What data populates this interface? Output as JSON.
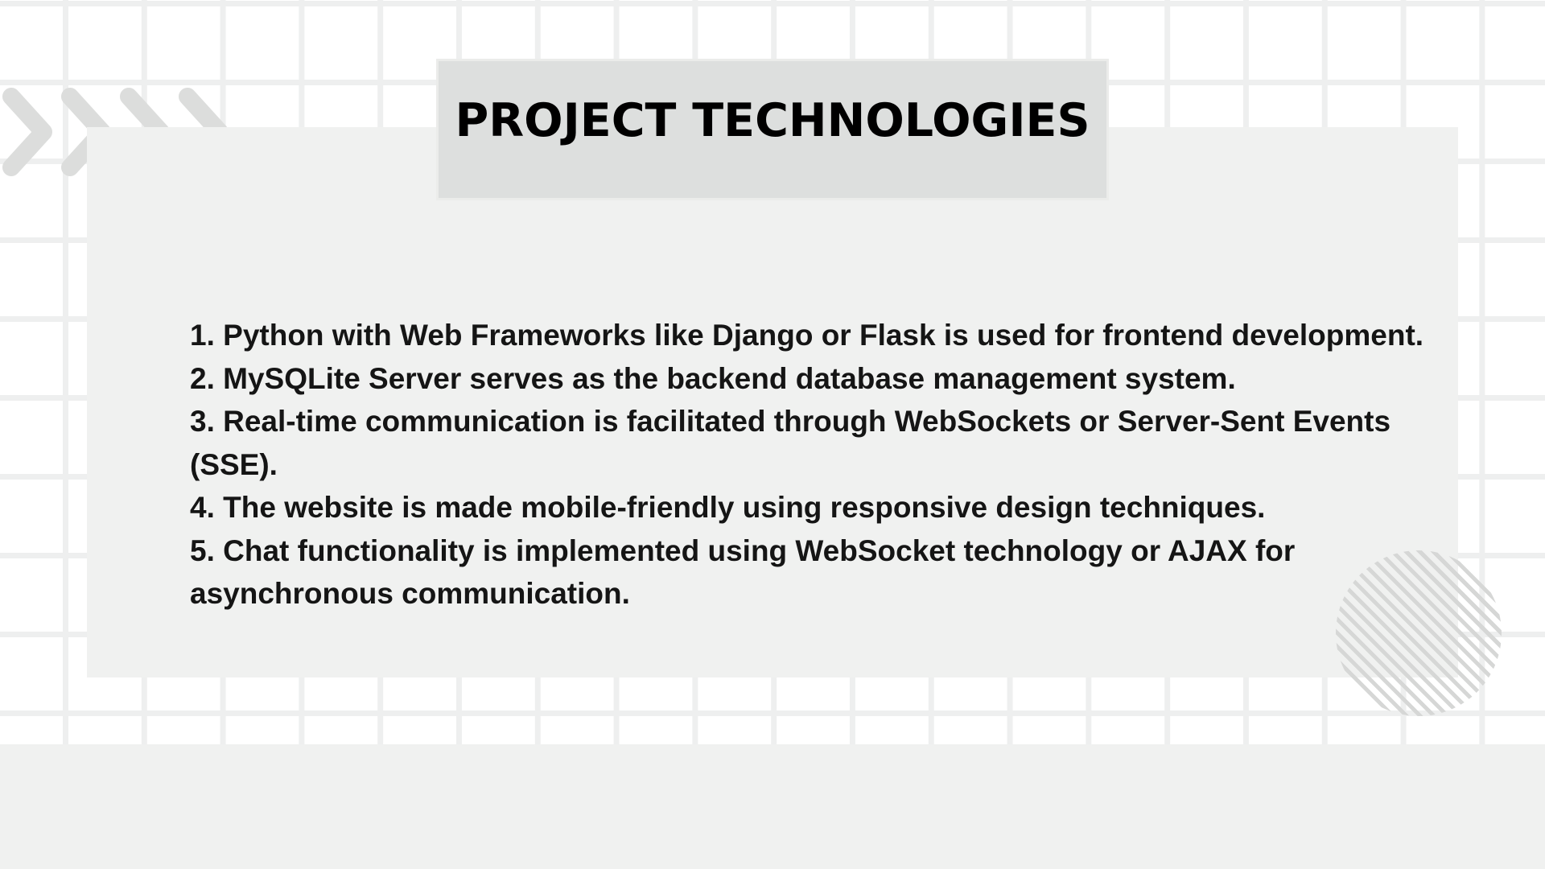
{
  "slide": {
    "title": "PROJECT TECHNOLOGIES",
    "items": [
      "1. Python with Web Frameworks like Django or Flask is used for frontend development.",
      "2. MySQLite Server serves as the backend database management system.",
      "3. Real-time communication is facilitated through WebSockets or Server-Sent Events (SSE).",
      "4. The website is made mobile-friendly using responsive design techniques.",
      "5. Chat functionality is implemented using WebSocket technology or AJAX for asynchronous communication."
    ]
  },
  "decorations": {
    "chevrons_icon": "chevron-right-icon",
    "circle_icon": "striped-circle-decoration"
  },
  "colors": {
    "background": "#ffffff",
    "grid_line": "#eeefef",
    "panel": "#f0f1f0",
    "title_box": "#dddfde",
    "decoration": "#d6d7d6",
    "text": "#151515"
  }
}
